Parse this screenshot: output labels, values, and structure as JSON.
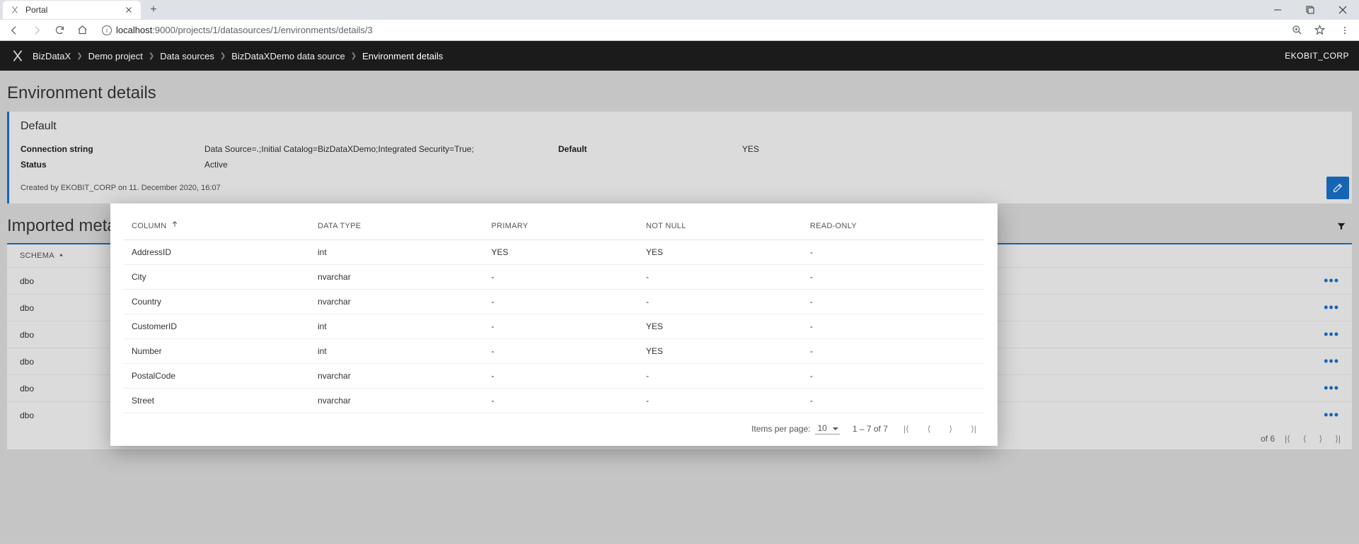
{
  "browser": {
    "tab_title": "Portal",
    "url_host": "localhost",
    "url_port_path": ":9000/projects/1/datasources/1/environments/details/3"
  },
  "header": {
    "product": "BizDataX",
    "breadcrumbs": [
      "Demo project",
      "Data sources",
      "BizDataXDemo data source",
      "Environment details"
    ],
    "user": "EKOBIT_CORP"
  },
  "page": {
    "title": "Environment details",
    "card_title": "Default",
    "conn_label": "Connection string",
    "conn_value": "Data Source=.;Initial Catalog=BizDataXDemo;Integrated Security=True;",
    "default_label": "Default",
    "default_value": "YES",
    "status_label": "Status",
    "status_value": "Active",
    "created": "Created by EKOBIT_CORP  on 11. December 2020, 16:07",
    "metadata_title": "Imported metadata",
    "schema_header": "SCHEMA",
    "bg_rows": [
      "dbo",
      "dbo",
      "dbo",
      "dbo",
      "dbo",
      "dbo"
    ],
    "bg_range": "of 6"
  },
  "modal": {
    "columns": [
      "COLUMN",
      "DATA TYPE",
      "PRIMARY",
      "NOT NULL",
      "READ-ONLY"
    ],
    "rows": [
      {
        "c": "AddressID",
        "t": "int",
        "p": "YES",
        "n": "YES",
        "r": "-"
      },
      {
        "c": "City",
        "t": "nvarchar",
        "p": "-",
        "n": "-",
        "r": "-"
      },
      {
        "c": "Country",
        "t": "nvarchar",
        "p": "-",
        "n": "-",
        "r": "-"
      },
      {
        "c": "CustomerID",
        "t": "int",
        "p": "-",
        "n": "YES",
        "r": "-"
      },
      {
        "c": "Number",
        "t": "int",
        "p": "-",
        "n": "YES",
        "r": "-"
      },
      {
        "c": "PostalCode",
        "t": "nvarchar",
        "p": "-",
        "n": "-",
        "r": "-"
      },
      {
        "c": "Street",
        "t": "nvarchar",
        "p": "-",
        "n": "-",
        "r": "-"
      }
    ],
    "items_label": "Items per page:",
    "page_size": "10",
    "range": "1 – 7 of 7"
  }
}
